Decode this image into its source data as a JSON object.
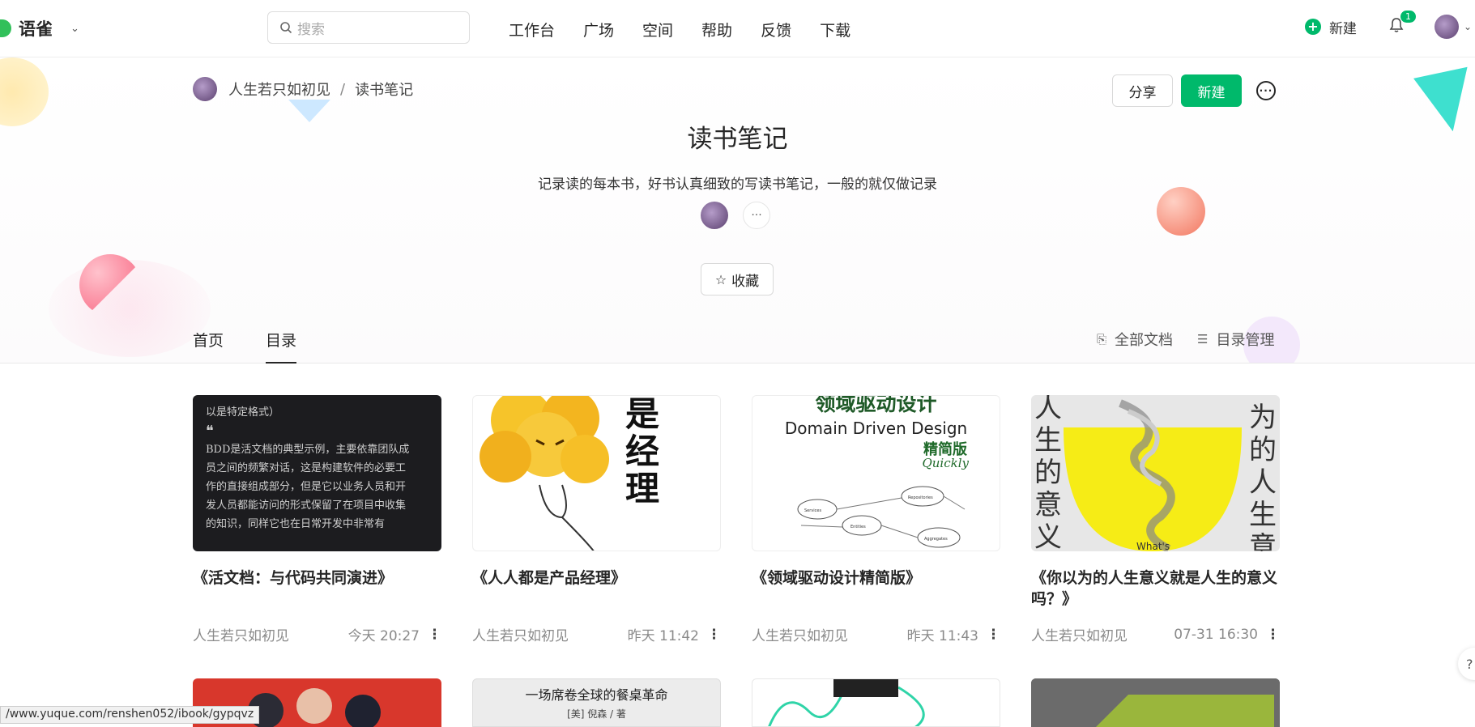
{
  "app": {
    "name": "语雀"
  },
  "search": {
    "placeholder": "搜索"
  },
  "nav": [
    "工作台",
    "广场",
    "空间",
    "帮助",
    "反馈",
    "下载"
  ],
  "top_right": {
    "new_label": "新建",
    "notification_count": "1"
  },
  "breadcrumb": {
    "owner": "人生若只如初见",
    "separator": "/",
    "book": "读书笔记"
  },
  "actions": {
    "share": "分享",
    "new": "新建",
    "more": "···"
  },
  "book": {
    "title": "读书笔记",
    "description": "记录读的每本书，好书认真细致的写读书笔记，一般的就仅做记录",
    "members_more": "···",
    "favorite": "收藏"
  },
  "tabs": {
    "home": "首页",
    "catalog": "目录",
    "all_docs": "全部文档",
    "catalog_manage": "目录管理"
  },
  "cards": [
    {
      "title": "《活文档：与代码共同演进》",
      "author": "人生若只如初见",
      "time": "今天 20:27",
      "cover_text": [
        "以是特定格式）",
        "❝",
        "BDD是活文档的典型示例，主要依靠团队成",
        "员之间的频繁对话，这是构建软件的必要工",
        "作的直接组成部分，但是它以业务人员和开",
        "发人员都能访问的形式保留了在项目中收集",
        "的知识，同样它也在日常开发中非常有"
      ]
    },
    {
      "title": "《人人都是产品经理》",
      "author": "人生若只如初见",
      "time": "昨天 11:42",
      "cover_text": [
        "是",
        "经",
        "理"
      ]
    },
    {
      "title": "《领域驱动设计精简版》",
      "author": "人生若只如初见",
      "time": "昨天 11:43",
      "cover_text": [
        "领域驱动设计",
        "Domain Driven Design",
        "精简版",
        "Quickly",
        "Services",
        "Entities",
        "Repositories",
        "Aggregates"
      ]
    },
    {
      "title": "《你以为的人生意义就是人生的意义吗？》",
      "author": "人生若只如初见",
      "time": "07-31 16:30",
      "cover_text": [
        "人生的意义",
        "为的人生意",
        "What's"
      ]
    }
  ],
  "row2_covers": [
    "一场席卷全球的餐桌革命",
    "[美] 倪森 / 著"
  ],
  "status_url": "/www.yuque.com/renshen052/ibook/gypqvz",
  "help_label": "?",
  "colors": {
    "brand": "#00b96b",
    "text": "#262626",
    "muted": "#8a8a8a"
  }
}
